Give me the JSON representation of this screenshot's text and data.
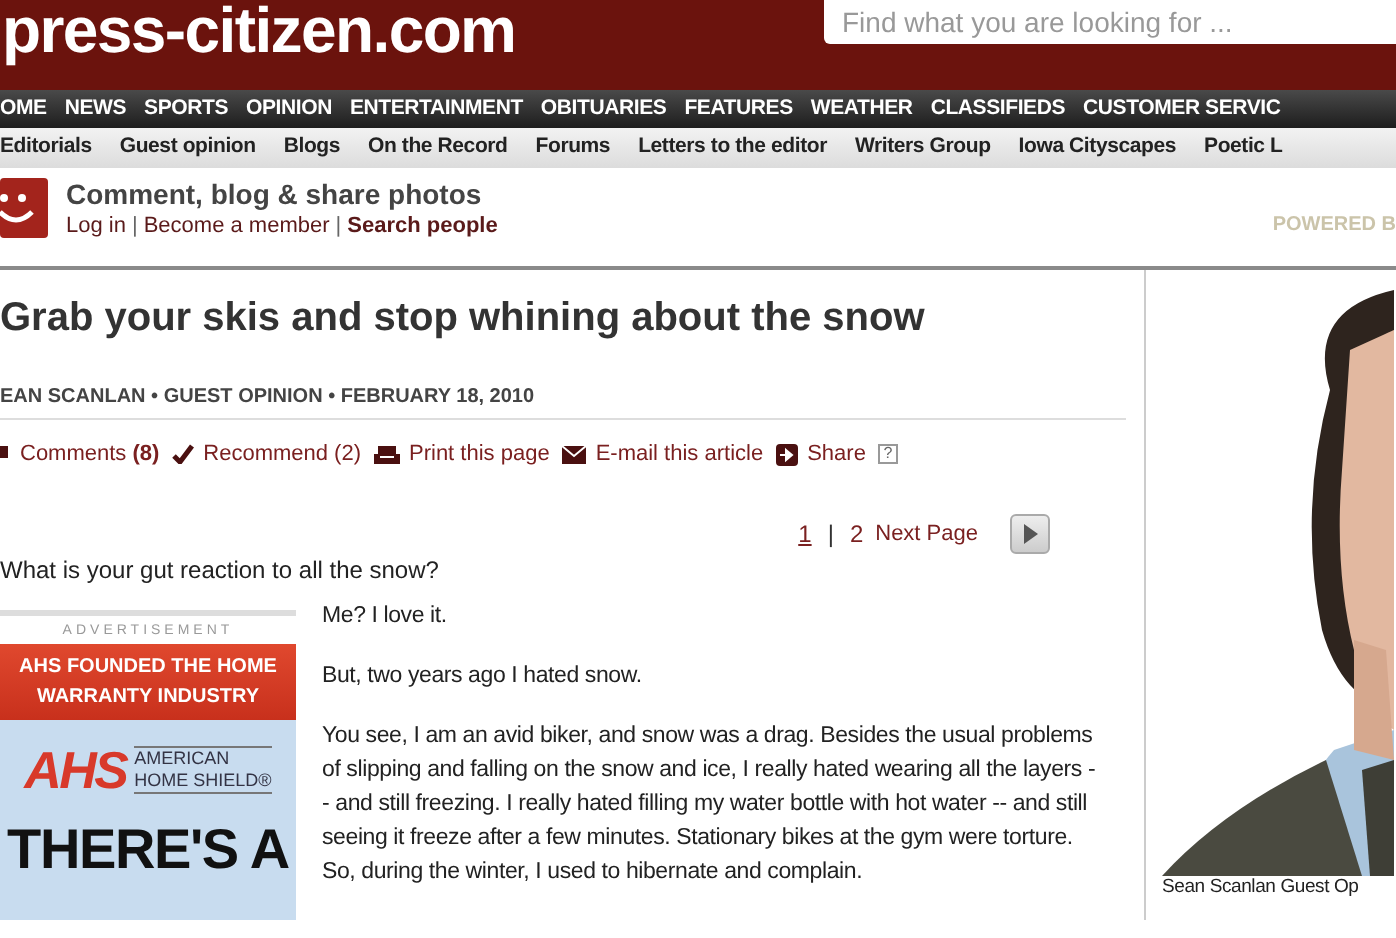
{
  "header": {
    "logo": "press-citizen.com",
    "search": {
      "placeholder": "Find what you are looking for ..."
    }
  },
  "nav": [
    "OME",
    "NEWS",
    "SPORTS",
    "OPINION",
    "ENTERTAINMENT",
    "OBITUARIES",
    "FEATURES",
    "WEATHER",
    "CLASSIFIEDS",
    "CUSTOMER SERVIC"
  ],
  "subnav": [
    "Editorials",
    "Guest opinion",
    "Blogs",
    "On the Record",
    "Forums",
    "Letters to the editor",
    "Writers Group",
    "Iowa Cityscapes",
    "Poetic L"
  ],
  "community": {
    "title": "Comment, blog & share photos",
    "links": [
      {
        "label": "Log in",
        "bold": false
      },
      {
        "label": "Become a member",
        "bold": false
      },
      {
        "label": "Search people",
        "bold": true
      }
    ],
    "separator": "|",
    "powered": "POWERED B"
  },
  "article": {
    "title": "Grab your skis and stop whining about the snow",
    "byline": "EAN SCANLAN • GUEST OPINION • FEBRUARY 18, 2010",
    "actions": [
      {
        "kind": "comments",
        "label": "Comments",
        "count": "(8)"
      },
      {
        "kind": "recommend",
        "label": "Recommend (2)"
      },
      {
        "kind": "print",
        "label": "Print this page"
      },
      {
        "kind": "email",
        "label": "E-mail this article"
      },
      {
        "kind": "share",
        "label": "Share",
        "help": "?"
      }
    ],
    "page_separator": "|",
    "pages": [
      {
        "label": "1",
        "selected": true
      },
      {
        "label": "2",
        "selected": false
      }
    ],
    "next": "Next Page",
    "lead": "What is your gut reaction to all the snow?",
    "paragraphs": [
      "Me? I love it.",
      "But, two years ago I hated snow.",
      "You see, I am an avid biker, and snow was a drag. Besides the usual problems of slipping and falling on the snow and ice, I really hated wearing all the layers -- and still freezing. I really hated filling my water bottle with hot water -- and still seeing it freeze after a few minutes. Stationary bikes at the gym were torture. So, during the winter, I used to hibernate and complain."
    ]
  },
  "ad": {
    "label": "ADVERTISEMENT",
    "banner": "AHS FOUNDED THE HOME WARRANTY INDUSTRY",
    "logo": "AHS",
    "brand": [
      "AMERICAN",
      "HOME SHIELD®"
    ],
    "headline": "THERE'S A"
  },
  "photo": {
    "kind": "picture",
    "caption": "Sean Scanlan Guest Op"
  }
}
